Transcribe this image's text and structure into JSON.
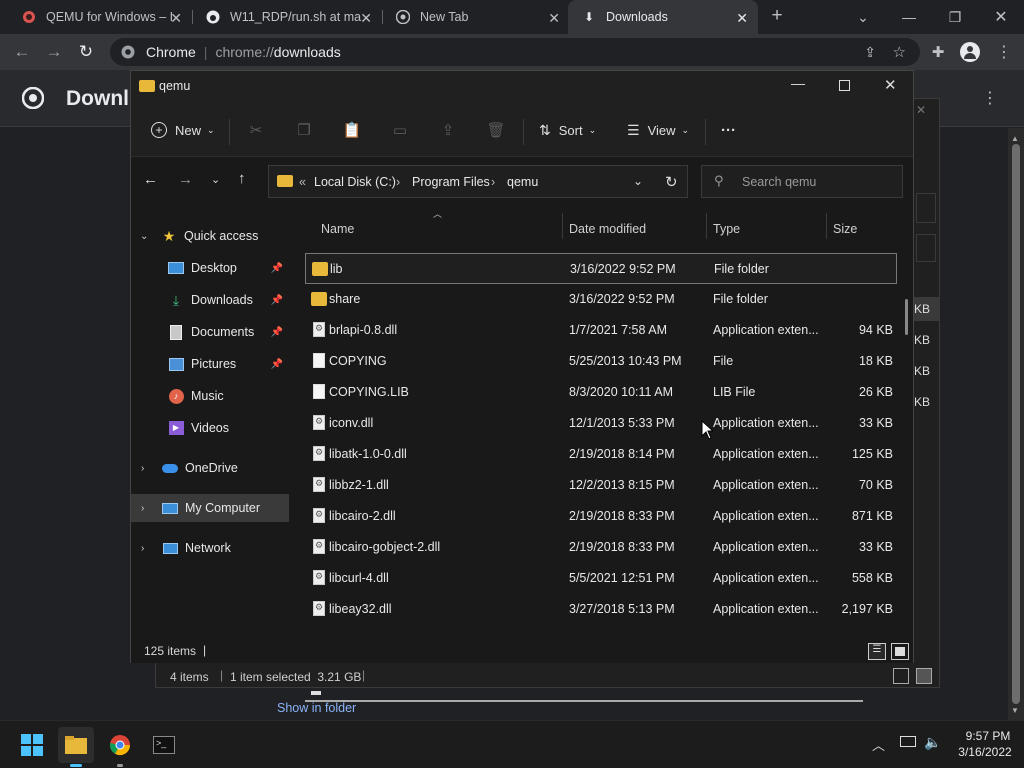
{
  "chrome": {
    "tabs": [
      {
        "title": "QEMU for Windows – I"
      },
      {
        "title": "W11_RDP/run.sh at ma"
      },
      {
        "title": "New Tab"
      },
      {
        "title": "Downloads"
      }
    ],
    "new_tab": "+",
    "omnibox": {
      "scheme_label": "Chrome",
      "url_prefix": "chrome://",
      "url_path": "downloads"
    },
    "downloads": {
      "title": "Downl",
      "side_sizes": [
        "KB",
        "KB",
        "KB",
        "KB"
      ],
      "status_items": "4 items",
      "status_selected": "1 item selected  3.21 GB",
      "show_in_folder": "Show in folder"
    }
  },
  "explorer": {
    "title": "qemu",
    "toolbar": {
      "new_label": "New",
      "sort_label": "Sort",
      "view_label": "View",
      "more_label": "···"
    },
    "address": {
      "prefix": "«",
      "crumbs": [
        "Local Disk (C:)",
        "Program Files",
        "qemu"
      ]
    },
    "search": {
      "placeholder": "Search qemu"
    },
    "nav": {
      "quick_access": "Quick access",
      "items": [
        "Desktop",
        "Downloads",
        "Documents",
        "Pictures",
        "Music",
        "Videos"
      ],
      "onedrive": "OneDrive",
      "my_computer": "My Computer",
      "network": "Network"
    },
    "columns": {
      "name": "Name",
      "date": "Date modified",
      "type": "Type",
      "size": "Size"
    },
    "files": [
      {
        "name": "lib",
        "date": "3/16/2022 9:52 PM",
        "type": "File folder",
        "size": "",
        "icon": "folder"
      },
      {
        "name": "share",
        "date": "3/16/2022 9:52 PM",
        "type": "File folder",
        "size": "",
        "icon": "folder"
      },
      {
        "name": "brlapi-0.8.dll",
        "date": "1/7/2021 7:58 AM",
        "type": "Application exten...",
        "size": "94 KB",
        "icon": "dll"
      },
      {
        "name": "COPYING",
        "date": "5/25/2013 10:43 PM",
        "type": "File",
        "size": "18 KB",
        "icon": "file"
      },
      {
        "name": "COPYING.LIB",
        "date": "8/3/2020 10:11 AM",
        "type": "LIB File",
        "size": "26 KB",
        "icon": "file"
      },
      {
        "name": "iconv.dll",
        "date": "12/1/2013 5:33 PM",
        "type": "Application exten...",
        "size": "33 KB",
        "icon": "dll"
      },
      {
        "name": "libatk-1.0-0.dll",
        "date": "2/19/2018 8:14 PM",
        "type": "Application exten...",
        "size": "125 KB",
        "icon": "dll"
      },
      {
        "name": "libbz2-1.dll",
        "date": "12/2/2013 8:15 PM",
        "type": "Application exten...",
        "size": "70 KB",
        "icon": "dll"
      },
      {
        "name": "libcairo-2.dll",
        "date": "2/19/2018 8:33 PM",
        "type": "Application exten...",
        "size": "871 KB",
        "icon": "dll"
      },
      {
        "name": "libcairo-gobject-2.dll",
        "date": "2/19/2018 8:33 PM",
        "type": "Application exten...",
        "size": "33 KB",
        "icon": "dll"
      },
      {
        "name": "libcurl-4.dll",
        "date": "5/5/2021 12:51 PM",
        "type": "Application exten...",
        "size": "558 KB",
        "icon": "dll"
      },
      {
        "name": "libeay32.dll",
        "date": "3/27/2018 5:13 PM",
        "type": "Application exten...",
        "size": "2,197 KB",
        "icon": "dll"
      }
    ],
    "status": "125 items",
    "status_sep": "|"
  },
  "taskbar": {
    "time": "9:57 PM",
    "date": "3/16/2022"
  }
}
